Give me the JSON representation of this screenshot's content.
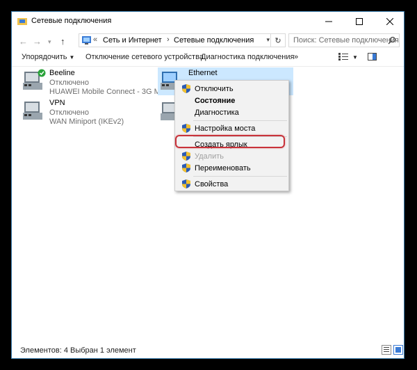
{
  "window": {
    "title": "Сетевые подключения"
  },
  "navigation": {
    "breadcrumb_overflow": "«",
    "breadcrumbs": [
      "Сеть и Интернет",
      "Сетевые подключения"
    ],
    "search_placeholder": "Поиск: Сетевые подключения"
  },
  "commands": {
    "organize": "Упорядочить",
    "disable_device": "Отключение сетевого устройства",
    "diagnose": "Диагностика подключения",
    "more": "»"
  },
  "connections": [
    {
      "name": "Beeline",
      "status": "Отключено",
      "device": "HUAWEI Mobile Connect - 3G Mo..."
    },
    {
      "name": "VPN",
      "status": "Отключено",
      "device": "WAN Miniport (IKEv2)"
    },
    {
      "name": "Ethernet",
      "status": "",
      "device": ""
    }
  ],
  "context_menu": {
    "items": [
      "Отключить",
      "Состояние",
      "Диагностика",
      "Настройка моста",
      "Создать ярлык",
      "Удалить",
      "Переименовать",
      "Свойства"
    ]
  },
  "statusbar": {
    "item_count": "Элементов: 4",
    "selection": "Выбран 1 элемент"
  },
  "colors": {
    "accent": "#cce8ff",
    "highlight_ring": "#c8323a",
    "shield_blue": "#2b5bb5",
    "shield_yellow": "#f2c12e",
    "connected_check": "#2aa33a"
  }
}
